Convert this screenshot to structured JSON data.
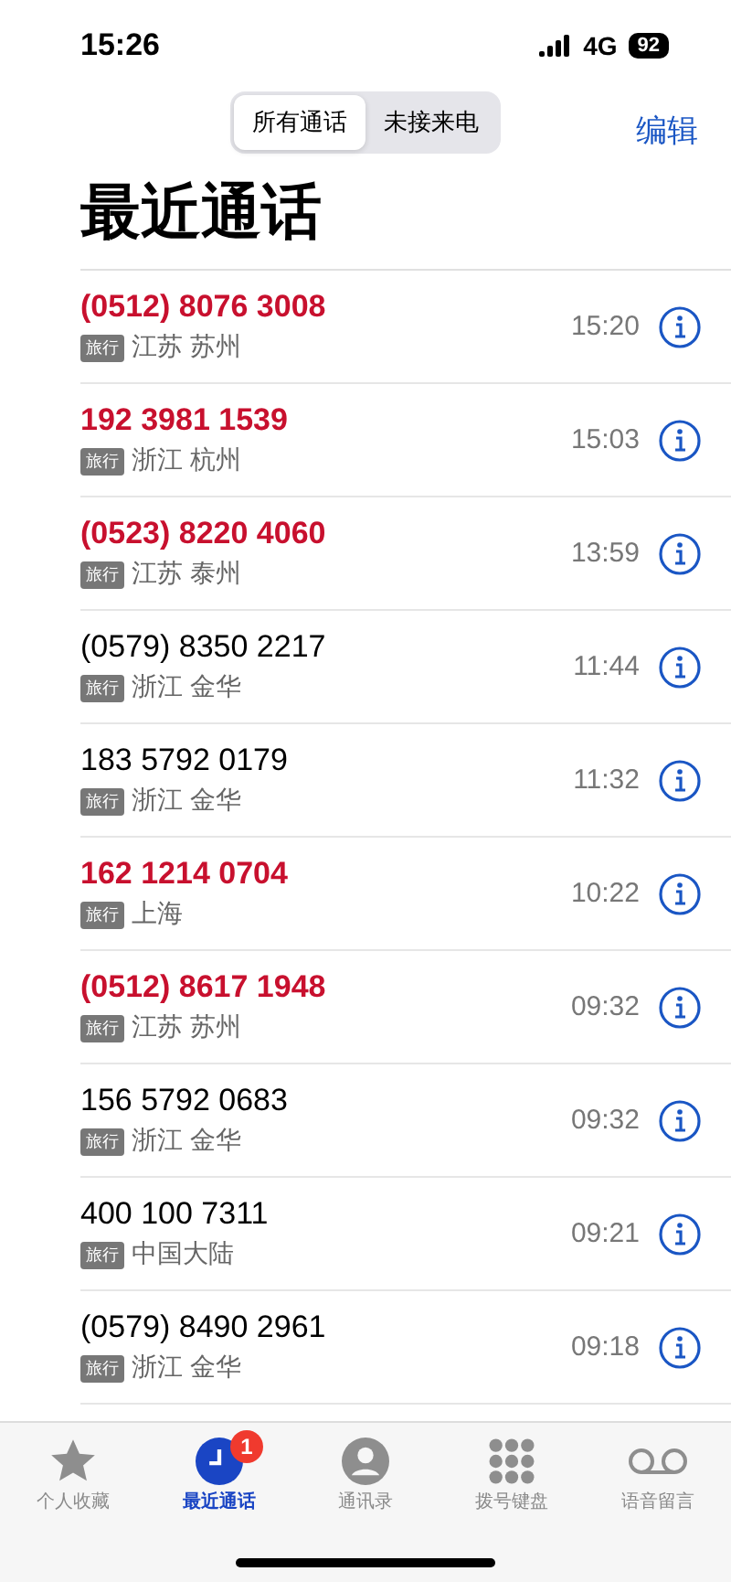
{
  "status_bar": {
    "time": "15:26",
    "network": "4G",
    "battery": "92"
  },
  "segments": [
    {
      "label": "所有通话",
      "selected": true
    },
    {
      "label": "未接来电",
      "selected": false
    }
  ],
  "edit_button": "编辑",
  "title": "最近通话",
  "calls": [
    {
      "number": "(0512) 8076 3008",
      "missed": true,
      "tag": "旅行",
      "location": "江苏 苏州",
      "time": "15:20"
    },
    {
      "number": "192 3981 1539",
      "missed": true,
      "tag": "旅行",
      "location": "浙江 杭州",
      "time": "15:03"
    },
    {
      "number": "(0523) 8220 4060",
      "missed": true,
      "tag": "旅行",
      "location": "江苏 泰州",
      "time": "13:59"
    },
    {
      "number": "(0579) 8350 2217",
      "missed": false,
      "tag": "旅行",
      "location": "浙江 金华",
      "time": "11:44"
    },
    {
      "number": "183 5792 0179",
      "missed": false,
      "tag": "旅行",
      "location": "浙江 金华",
      "time": "11:32"
    },
    {
      "number": "162 1214 0704",
      "missed": true,
      "tag": "旅行",
      "location": "上海",
      "time": "10:22"
    },
    {
      "number": "(0512) 8617 1948",
      "missed": true,
      "tag": "旅行",
      "location": "江苏 苏州",
      "time": "09:32"
    },
    {
      "number": "156 5792 0683",
      "missed": false,
      "tag": "旅行",
      "location": "浙江 金华",
      "time": "09:32"
    },
    {
      "number": "400 100 7311",
      "missed": false,
      "tag": "旅行",
      "location": "中国大陆",
      "time": "09:21"
    },
    {
      "number": "(0579) 8490 2961",
      "missed": false,
      "tag": "旅行",
      "location": "浙江 金华",
      "time": "09:18"
    }
  ],
  "tab_bar": [
    {
      "kind": "favorites",
      "label": "个人收藏",
      "selected": false
    },
    {
      "kind": "recents",
      "label": "最近通话",
      "selected": true,
      "badge": "1"
    },
    {
      "kind": "contacts",
      "label": "通讯录",
      "selected": false
    },
    {
      "kind": "keypad",
      "label": "拨号键盘",
      "selected": false
    },
    {
      "kind": "voicemail",
      "label": "语音留言",
      "selected": false
    }
  ]
}
